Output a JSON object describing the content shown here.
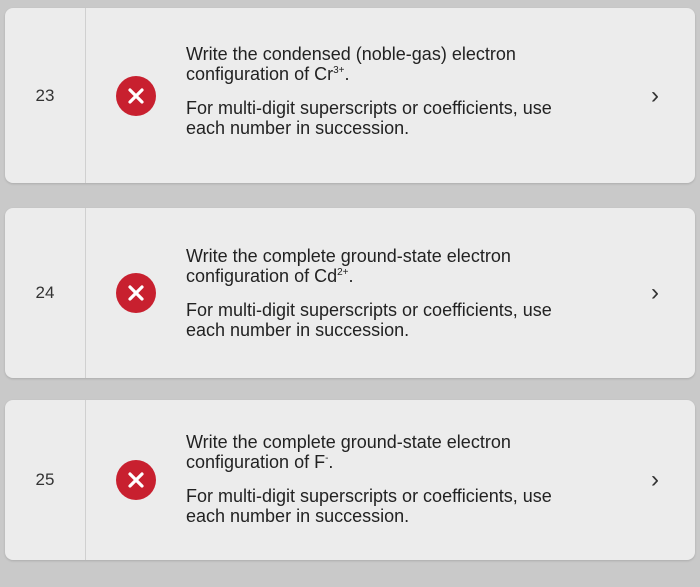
{
  "questions": [
    {
      "number": "23",
      "status_icon": "x-icon",
      "prompt_line1": "Write the condensed (noble-gas) electron",
      "prompt_line2_prefix": "configuration of Cr",
      "prompt_sup": "3+",
      "prompt_suffix": ".",
      "instruction_line1": "For multi-digit superscripts or coefficients, use",
      "instruction_line2": "each number in succession.",
      "chevron": "›"
    },
    {
      "number": "24",
      "status_icon": "x-icon",
      "prompt_line1": "Write the complete ground-state electron",
      "prompt_line2_prefix": "configuration of Cd",
      "prompt_sup": "2+",
      "prompt_suffix": ".",
      "instruction_line1": "For multi-digit superscripts or coefficients, use",
      "instruction_line2": "each number in succession.",
      "chevron": "›"
    },
    {
      "number": "25",
      "status_icon": "x-icon",
      "prompt_line1": "Write the complete ground-state electron",
      "prompt_line2_prefix": "configuration of F",
      "prompt_sup": "-",
      "prompt_suffix": ".",
      "instruction_line1": "For multi-digit superscripts or coefficients, use",
      "instruction_line2": "each number in succession.",
      "chevron": "›"
    }
  ],
  "colors": {
    "incorrect_badge": "#c8202f",
    "card_background": "#ececec",
    "page_background": "#c9c9c9"
  }
}
